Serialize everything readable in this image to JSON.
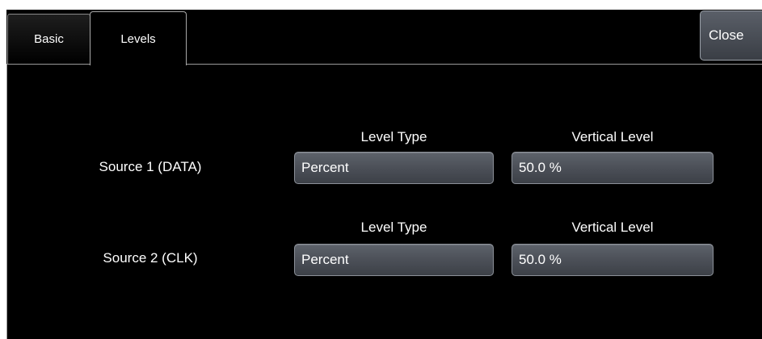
{
  "tabs": [
    {
      "label": "Basic",
      "active": false
    },
    {
      "label": "Levels",
      "active": true
    }
  ],
  "close_label": "Close",
  "rows": [
    {
      "source_label": "Source 1 (DATA)",
      "level_type_header": "Level Type",
      "vertical_level_header": "Vertical Level",
      "level_type_value": "Percent",
      "vertical_level_value": "50.0 %"
    },
    {
      "source_label": "Source 2 (CLK)",
      "level_type_header": "Level Type",
      "vertical_level_header": "Vertical Level",
      "level_type_value": "Percent",
      "vertical_level_value": "50.0 %"
    }
  ],
  "colors": {
    "background": "#000000",
    "field": "#4a4e56",
    "text": "#ffffff"
  }
}
